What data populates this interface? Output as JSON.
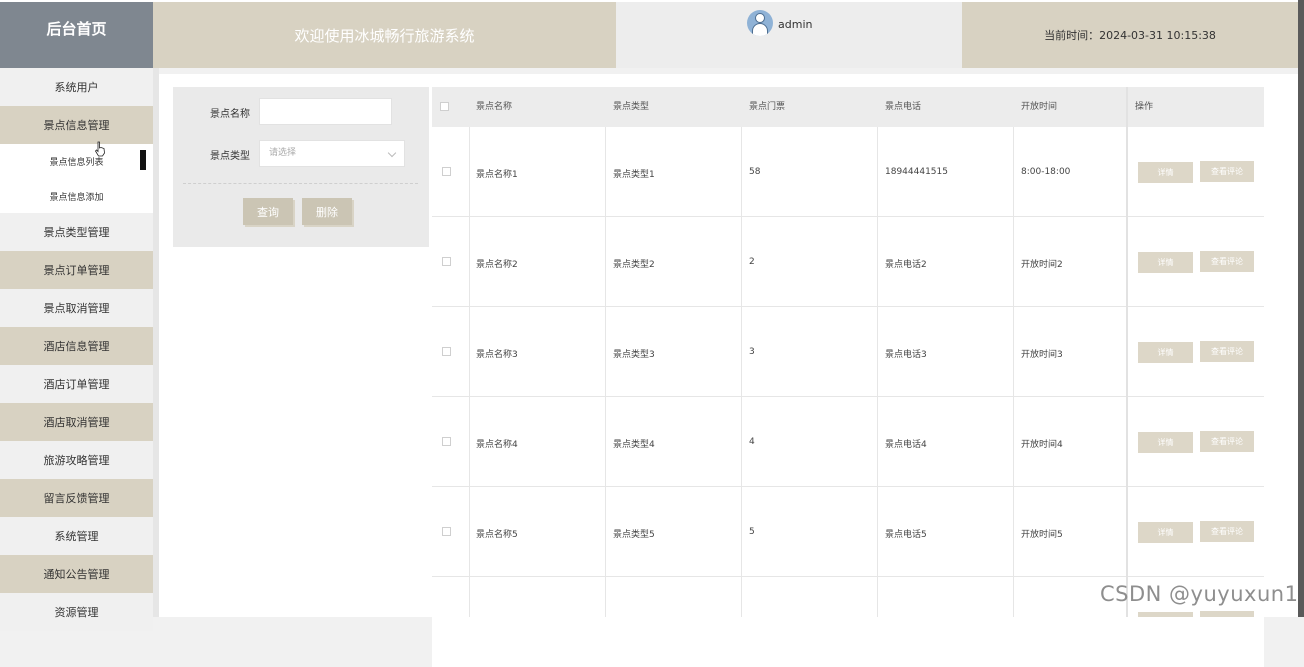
{
  "header": {
    "brand": "后台首页",
    "welcome": "欢迎使用冰城畅行旅游系统",
    "username": "admin",
    "time_label": "当前时间：",
    "time_value": "2024-03-31 10:15:38"
  },
  "sidebar": {
    "items": [
      {
        "label": "系统用户"
      },
      {
        "label": "景点信息管理"
      },
      {
        "label": "景点信息列表"
      },
      {
        "label": "景点信息添加"
      },
      {
        "label": "景点类型管理"
      },
      {
        "label": "景点订单管理"
      },
      {
        "label": "景点取消管理"
      },
      {
        "label": "酒店信息管理"
      },
      {
        "label": "酒店订单管理"
      },
      {
        "label": "酒店取消管理"
      },
      {
        "label": "旅游攻略管理"
      },
      {
        "label": "留言反馈管理"
      },
      {
        "label": "系统管理"
      },
      {
        "label": "通知公告管理"
      },
      {
        "label": "资源管理"
      }
    ]
  },
  "search": {
    "name_label": "景点名称",
    "type_label": "景点类型",
    "type_placeholder": "请选择",
    "query_button": "查询",
    "delete_button": "删除"
  },
  "table": {
    "headers": [
      "景点名称",
      "景点类型",
      "景点门票",
      "景点电话",
      "开放时间",
      "操作"
    ],
    "detail_button": "详情",
    "review_button": "查看评论",
    "rows": [
      {
        "name": "景点名称1",
        "type": "景点类型1",
        "ticket": "58",
        "phone": "18944441515",
        "hours": "8:00-18:00"
      },
      {
        "name": "景点名称2",
        "type": "景点类型2",
        "ticket": "2",
        "phone": "景点电话2",
        "hours": "开放时间2"
      },
      {
        "name": "景点名称3",
        "type": "景点类型3",
        "ticket": "3",
        "phone": "景点电话3",
        "hours": "开放时间3"
      },
      {
        "name": "景点名称4",
        "type": "景点类型4",
        "ticket": "4",
        "phone": "景点电话4",
        "hours": "开放时间4"
      },
      {
        "name": "景点名称5",
        "type": "景点类型5",
        "ticket": "5",
        "phone": "景点电话5",
        "hours": "开放时间5"
      }
    ]
  },
  "watermark": "CSDN @yuyuxun1"
}
